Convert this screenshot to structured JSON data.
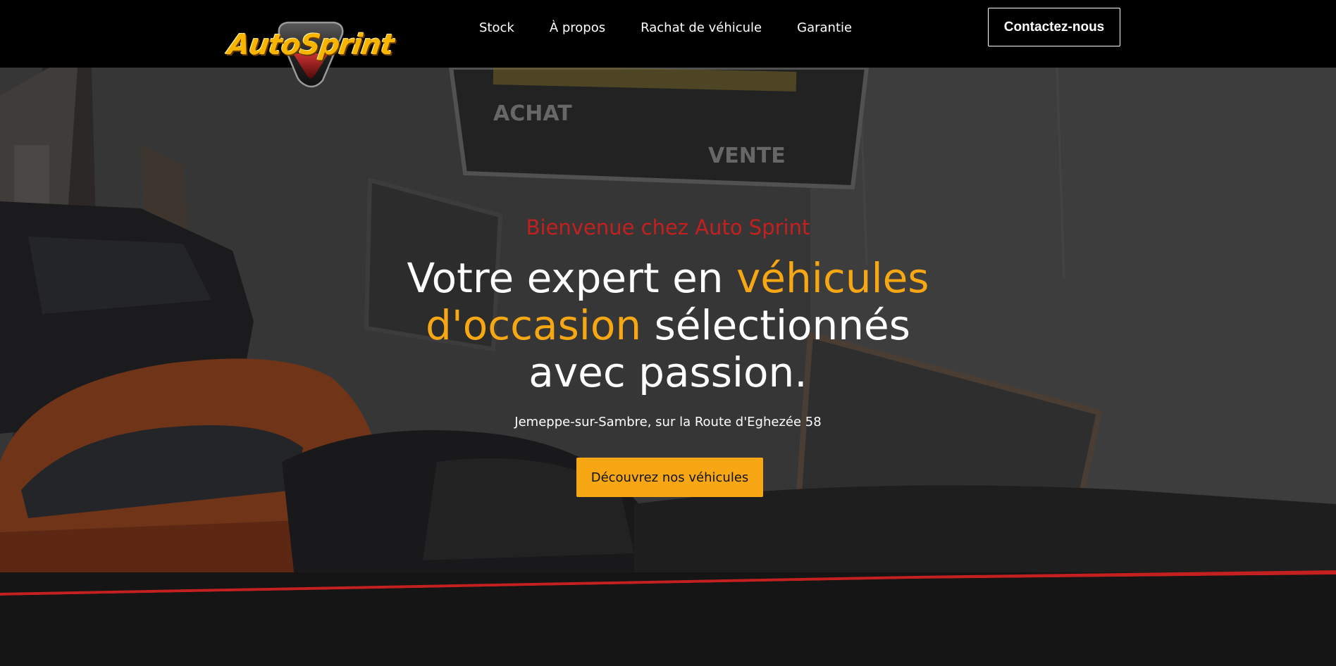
{
  "header": {
    "logo_text": "AutoSprint",
    "nav": [
      "Stock",
      "À propos",
      "Rachat de véhicule",
      "Garantie"
    ],
    "contact_label": "Contactez-nous"
  },
  "hero": {
    "welcome": "Bienvenue chez Auto Sprint",
    "headline_part1": "Votre expert en ",
    "headline_accent": "véhicules d'occasion",
    "headline_part2": " sélectionnés avec passion.",
    "address": "Jemeppe-sur-Sambre, sur la Route d'Eghezée 58",
    "cta_label": "Découvrez nos véhicules",
    "sign_text": [
      "ACHAT",
      "VENTE"
    ]
  },
  "colors": {
    "accent_orange": "#f6a713",
    "accent_red": "#c4201f",
    "header_bg": "#000000",
    "logo_yellow": "#f7b500"
  }
}
